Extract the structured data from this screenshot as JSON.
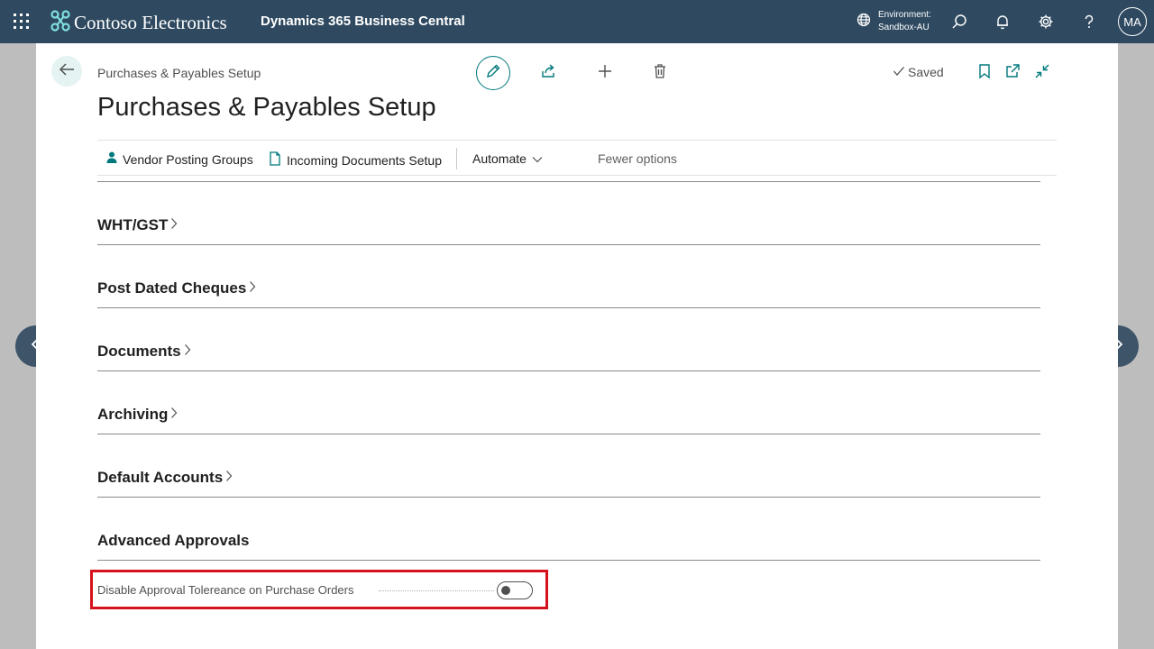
{
  "topbar": {
    "brand": "Contoso Electronics",
    "product": "Dynamics 365 Business Central",
    "environment_label": "Environment:",
    "environment_value": "Sandbox-AU",
    "avatar_initials": "MA",
    "icons": [
      "waffle-icon",
      "contoso-logo-icon",
      "environment-globe-icon",
      "search-icon",
      "bell-icon",
      "gear-icon",
      "help-icon"
    ]
  },
  "page": {
    "breadcrumb": "Purchases & Payables Setup",
    "title": "Purchases & Payables Setup",
    "saved_label": "Saved",
    "actions": [
      "edit-icon",
      "share-icon",
      "add-icon",
      "delete-icon",
      "bookmark-icon",
      "open-new-window-icon",
      "collapse-icon"
    ]
  },
  "actionbar": {
    "vendor_posting_groups": "Vendor Posting Groups",
    "incoming_documents_setup": "Incoming Documents Setup",
    "automate": "Automate",
    "fewer_options": "Fewer options"
  },
  "sections": {
    "wht_gst": "WHT/GST",
    "post_dated_cheques": "Post Dated Cheques",
    "documents": "Documents",
    "archiving": "Archiving",
    "default_accounts": "Default Accounts",
    "advanced_approvals": "Advanced Approvals"
  },
  "fields": {
    "disable_approval_tolerance": {
      "label": "Disable Approval Tolereance on Purchase Orders",
      "value": "off"
    }
  },
  "colors": {
    "topbar": "#2f4a60",
    "accent": "#00787c",
    "highlight": "#d5121b"
  }
}
